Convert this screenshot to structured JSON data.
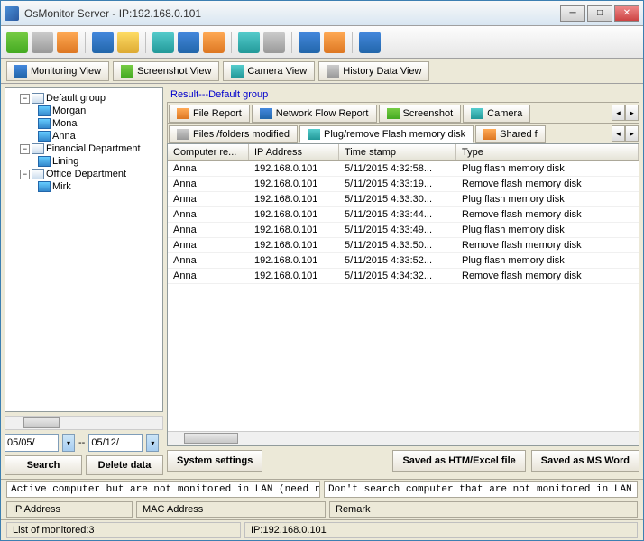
{
  "title": "OsMonitor Server -   IP:192.168.0.101",
  "views": {
    "monitoring": "Monitoring View",
    "screenshot": "Screenshot View",
    "camera": "Camera View",
    "history": "History Data View"
  },
  "tree": {
    "groups": [
      {
        "name": "Default group",
        "members": [
          "Morgan",
          "Mona",
          "Anna"
        ]
      },
      {
        "name": "Financial Department",
        "members": [
          "Lining"
        ]
      },
      {
        "name": "Office Department",
        "members": [
          "Mirk"
        ]
      }
    ]
  },
  "dateFrom": "05/05/",
  "dateTo": "05/12/",
  "dateSep": "--",
  "buttons": {
    "search": "Search",
    "delete": "Delete data"
  },
  "resultLabel": "Result---Default group",
  "reportTabs": {
    "row1": {
      "file": "File Report",
      "netflow": "Network Flow Report",
      "screenshot": "Screenshot",
      "camera": "Camera"
    },
    "row2": {
      "files": "Files /folders modified",
      "plug": "Plug/remove Flash memory disk",
      "shared": "Shared f"
    }
  },
  "columns": {
    "computer": "Computer re...",
    "ip": "IP Address",
    "time": "Time stamp",
    "type": "Type"
  },
  "rows": [
    {
      "c": "Anna",
      "ip": "192.168.0.101",
      "t": "5/11/2015 4:32:58...",
      "ty": "Plug flash memory disk"
    },
    {
      "c": "Anna",
      "ip": "192.168.0.101",
      "t": "5/11/2015 4:33:19...",
      "ty": "Remove flash memory disk"
    },
    {
      "c": "Anna",
      "ip": "192.168.0.101",
      "t": "5/11/2015 4:33:30...",
      "ty": "Plug flash memory disk"
    },
    {
      "c": "Anna",
      "ip": "192.168.0.101",
      "t": "5/11/2015 4:33:44...",
      "ty": "Remove flash memory disk"
    },
    {
      "c": "Anna",
      "ip": "192.168.0.101",
      "t": "5/11/2015 4:33:49...",
      "ty": "Plug flash memory disk"
    },
    {
      "c": "Anna",
      "ip": "192.168.0.101",
      "t": "5/11/2015 4:33:50...",
      "ty": "Remove flash memory disk"
    },
    {
      "c": "Anna",
      "ip": "192.168.0.101",
      "t": "5/11/2015 4:33:52...",
      "ty": "Plug flash memory disk"
    },
    {
      "c": "Anna",
      "ip": "192.168.0.101",
      "t": "5/11/2015 4:34:32...",
      "ty": "Remove flash memory disk"
    }
  ],
  "bottomButtons": {
    "sysset": "System settings",
    "htm": "Saved as HTM/Excel file",
    "word": "Saved as MS Word"
  },
  "footer": {
    "active": "Active computer but are not monitored in LAN (need run OsMon",
    "dontsearch": "Don't search computer that are not monitored in LAN",
    "ip": "IP Address",
    "mac": "MAC Address",
    "remark": "Remark"
  },
  "status": {
    "count": "List of monitored:3",
    "ip": "IP:192.168.0.101"
  }
}
